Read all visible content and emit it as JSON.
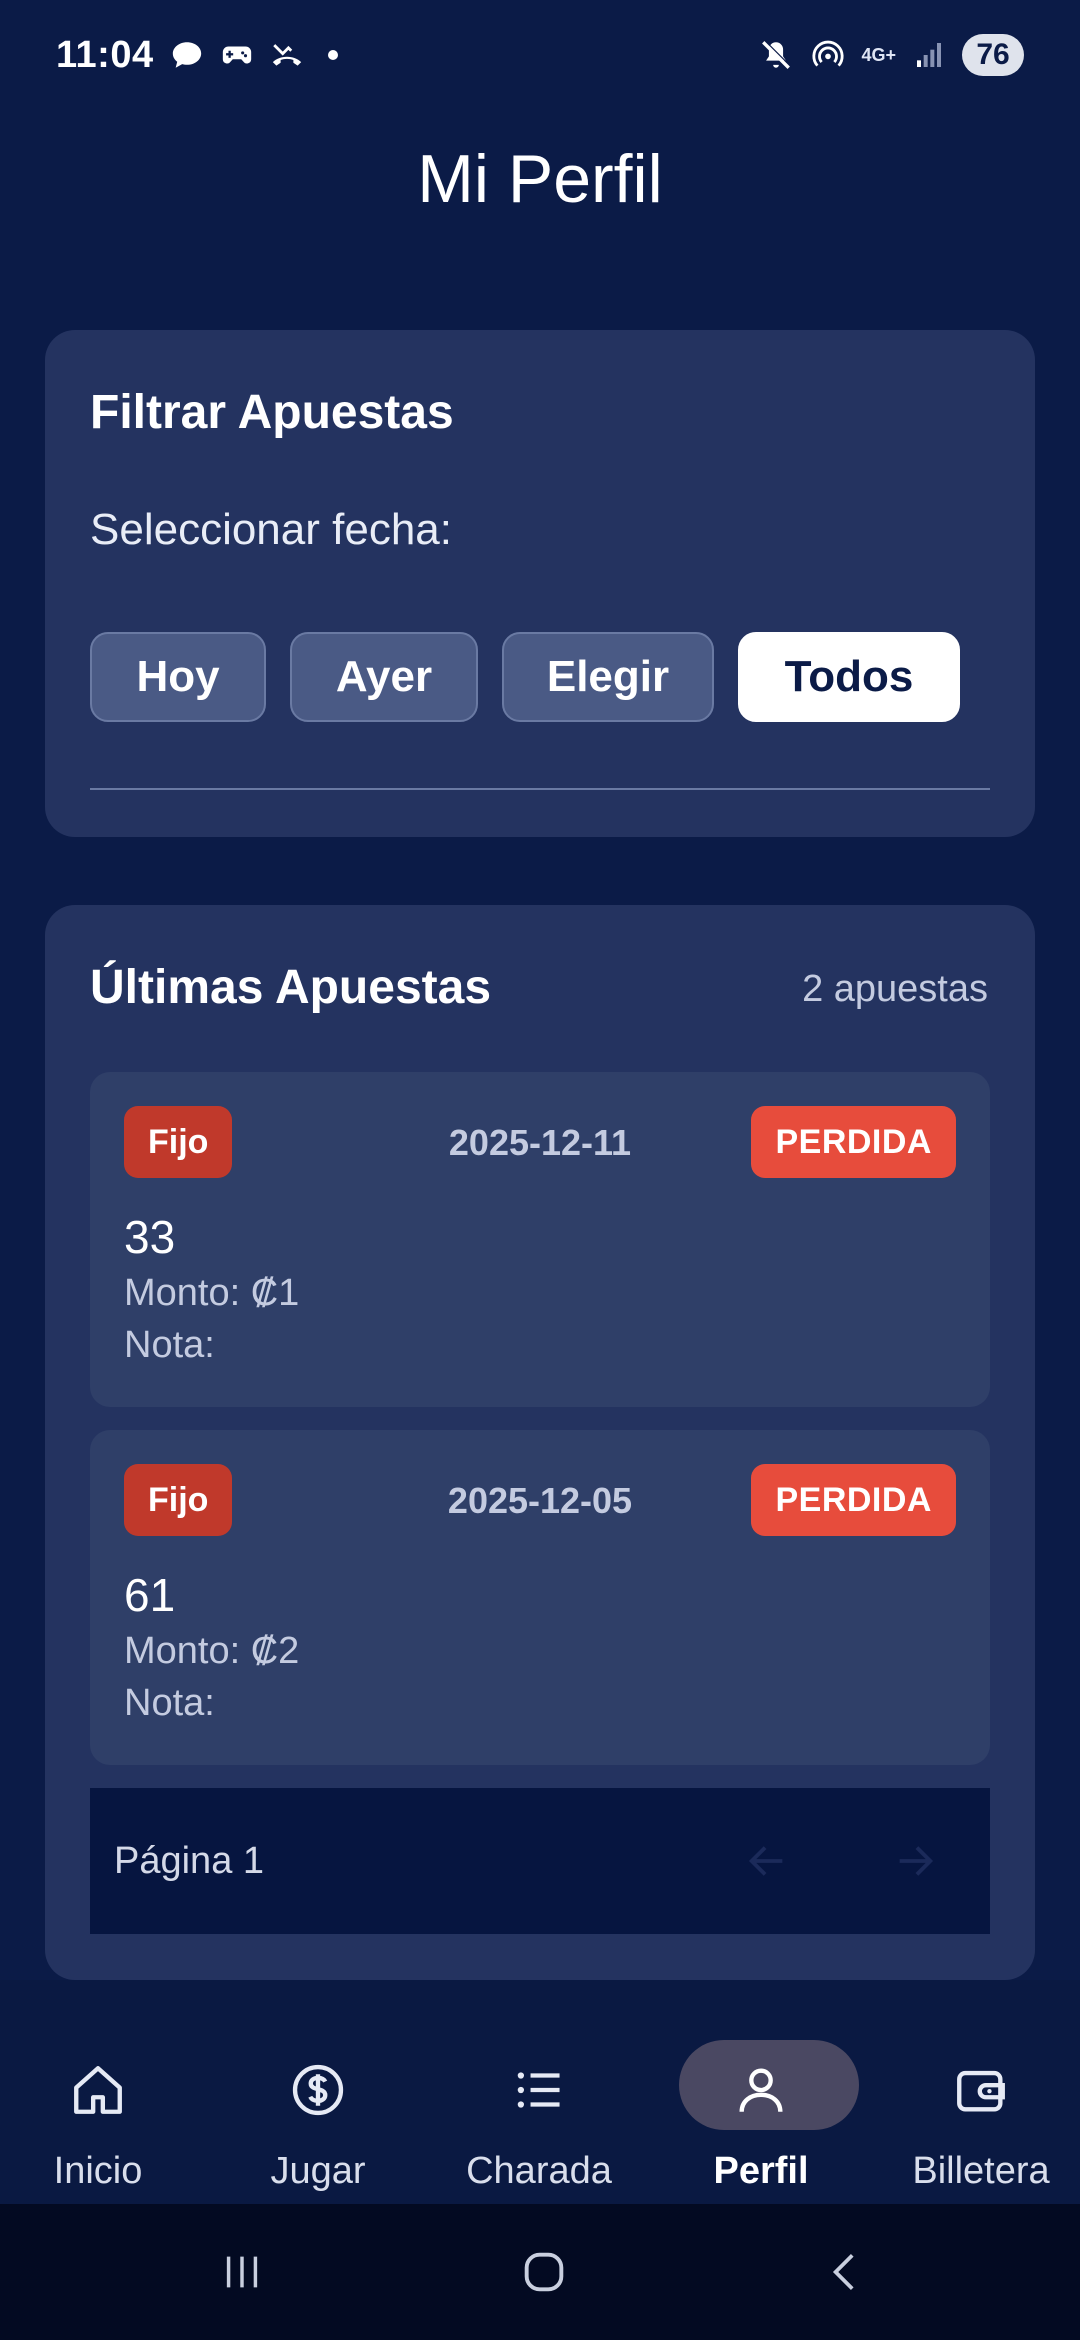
{
  "status_bar": {
    "time": "11:04",
    "network": "4G+",
    "battery": "76",
    "icons": [
      "chat-icon",
      "game-controller-icon",
      "missed-call-icon",
      "mute-icon",
      "hotspot-icon",
      "signal-icon"
    ]
  },
  "page": {
    "title": "Mi Perfil"
  },
  "filter": {
    "heading": "Filtrar Apuestas",
    "date_label": "Seleccionar fecha:",
    "chips": [
      {
        "label": "Hoy",
        "active": false
      },
      {
        "label": "Ayer",
        "active": false
      },
      {
        "label": "Elegir",
        "active": false
      },
      {
        "label": "Todos",
        "active": true
      }
    ]
  },
  "bets": {
    "heading": "Últimas Apuestas",
    "count": "2 apuestas",
    "items": [
      {
        "type": "Fijo",
        "date": "2025-12-11",
        "status": "PERDIDA",
        "number": "33",
        "amount": "Monto: ₡1",
        "note": "Nota:"
      },
      {
        "type": "Fijo",
        "date": "2025-12-05",
        "status": "PERDIDA",
        "number": "61",
        "amount": "Monto: ₡2",
        "note": "Nota:"
      }
    ],
    "pagination": {
      "label": "Página 1"
    }
  },
  "nav": {
    "items": [
      {
        "label": "Inicio",
        "icon": "home-icon",
        "active": false
      },
      {
        "label": "Jugar",
        "icon": "dollar-icon",
        "active": false
      },
      {
        "label": "Charada",
        "icon": "list-icon",
        "active": false
      },
      {
        "label": "Perfil",
        "icon": "person-icon",
        "active": true
      },
      {
        "label": "Billetera",
        "icon": "wallet-icon",
        "active": false
      }
    ]
  },
  "colors": {
    "background": "#0b1b47",
    "card": "#243360",
    "bet_card": "#2f3f68",
    "badge_type": "#c0392b",
    "badge_status": "#e74c3c"
  }
}
